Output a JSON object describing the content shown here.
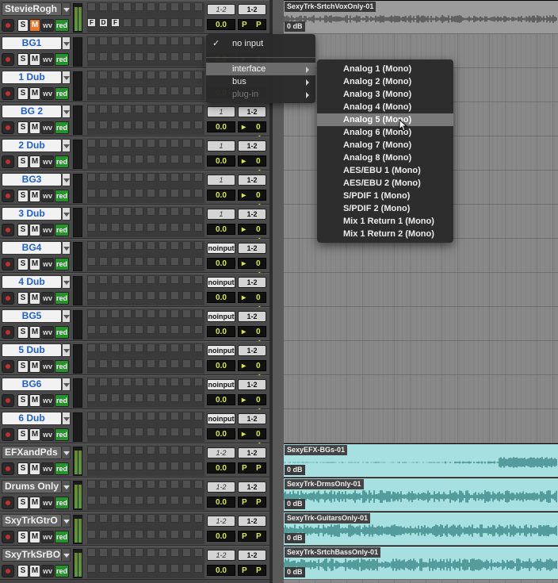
{
  "tracks": [
    {
      "name": "StevieRogh",
      "style": "gray",
      "m_on": true,
      "io1": "1-2",
      "io1_style": "italic",
      "io2": "1-2",
      "vol": "0.0",
      "pan_a": "P",
      "pan_b": "P",
      "extra_ins": [
        "F",
        "D",
        "F"
      ]
    },
    {
      "name": "BG1",
      "style": "blue",
      "m_on": false,
      "io1": "",
      "io2": "",
      "vol": "0.0",
      "pan_a": "▸",
      "pan_b": "0 ◂"
    },
    {
      "name": "1 Dub",
      "style": "blue",
      "m_on": false,
      "io1": "",
      "io2": "",
      "vol": "0.0",
      "pan_a": "▸",
      "pan_b": "0 ◂"
    },
    {
      "name": "BG 2",
      "style": "blue",
      "m_on": false,
      "io1": "1",
      "io1_style": "italic",
      "io2": "1-2",
      "vol": "0.0",
      "pan_a": "▸",
      "pan_b": "0 ◂"
    },
    {
      "name": "2 Dub",
      "style": "blue",
      "m_on": false,
      "io1": "1",
      "io1_style": "italic",
      "io2": "1-2",
      "vol": "0.0",
      "pan_a": "▸",
      "pan_b": "0 ◂"
    },
    {
      "name": "BG3",
      "style": "blue",
      "m_on": false,
      "io1": "1",
      "io1_style": "italic",
      "io2": "1-2",
      "vol": "0.0",
      "pan_a": "▸",
      "pan_b": "0 ◂"
    },
    {
      "name": "3 Dub",
      "style": "blue",
      "m_on": false,
      "io1": "1",
      "io1_style": "italic",
      "io2": "1-2",
      "vol": "0.0",
      "pan_a": "▸",
      "pan_b": "0 ◂"
    },
    {
      "name": "BG4",
      "style": "blue",
      "m_on": false,
      "io1": "noinput",
      "io1_style": "ni",
      "io2": "1-2",
      "vol": "0.0",
      "pan_a": "▸",
      "pan_b": "0 ◂"
    },
    {
      "name": "4 Dub",
      "style": "blue",
      "m_on": false,
      "io1": "noinput",
      "io1_style": "ni",
      "io2": "1-2",
      "vol": "0.0",
      "pan_a": "▸",
      "pan_b": "0 ◂"
    },
    {
      "name": "BG5",
      "style": "blue",
      "m_on": false,
      "io1": "noinput",
      "io1_style": "ni",
      "io2": "1-2",
      "vol": "0.0",
      "pan_a": "▸",
      "pan_b": "0 ◂"
    },
    {
      "name": "5 Dub",
      "style": "blue",
      "m_on": false,
      "io1": "noinput",
      "io1_style": "ni",
      "io2": "1-2",
      "vol": "0.0",
      "pan_a": "▸",
      "pan_b": "0 ◂"
    },
    {
      "name": "BG6",
      "style": "blue",
      "m_on": false,
      "io1": "noinput",
      "io1_style": "ni",
      "io2": "1-2",
      "vol": "0.0",
      "pan_a": "▸",
      "pan_b": "0 ◂"
    },
    {
      "name": "6 Dub",
      "style": "blue",
      "m_on": false,
      "io1": "noinput",
      "io1_style": "ni",
      "io2": "1-2",
      "vol": "0.0",
      "pan_a": "▸",
      "pan_b": "0 ◂"
    },
    {
      "name": "EFXandPds",
      "style": "gray",
      "m_on": false,
      "io1": "1-2",
      "io1_style": "italic",
      "io2": "1-2",
      "vol": "0.0",
      "pan_a": "P",
      "pan_b": "P"
    },
    {
      "name": "Drums Only",
      "style": "gray",
      "m_on": false,
      "io1": "1-2",
      "io1_style": "italic",
      "io2": "1-2",
      "vol": "0.0",
      "pan_a": "P",
      "pan_b": "P"
    },
    {
      "name": "SxyTrkGtrO",
      "style": "gray",
      "m_on": false,
      "io1": "1-2",
      "io1_style": "italic",
      "io2": "1-2",
      "vol": "0.0",
      "pan_a": "P",
      "pan_b": "P"
    },
    {
      "name": "SxyTrkSrBO",
      "style": "gray",
      "m_on": false,
      "io1": "1-2",
      "io1_style": "italic",
      "io2": "1-2",
      "vol": "0.0",
      "pan_a": "P",
      "pan_b": "P"
    }
  ],
  "buttons": {
    "s": "S",
    "m": "M",
    "wv": "wv",
    "red": "red"
  },
  "clips": [
    {
      "track_index": 0,
      "name": "SexyTrk-SrtchVoxOnly-01",
      "gain": "0 dB",
      "color": "gray"
    },
    {
      "track_index": 13,
      "name": "SexyEFX-BGs-01",
      "gain": "0 dB",
      "color": "teal"
    },
    {
      "track_index": 14,
      "name": "SexyTrk-DrmsOnly-01",
      "gain": "0 dB",
      "color": "teal"
    },
    {
      "track_index": 15,
      "name": "SexyTrk-GuitarsOnly-01",
      "gain": "0 dB",
      "color": "teal"
    },
    {
      "track_index": 16,
      "name": "SexyTrk-SrtchBassOnly-01",
      "gain": "0 dB",
      "color": "teal"
    }
  ],
  "input_menu": {
    "checked_item": "no input",
    "check_mark": "✓",
    "items": [
      {
        "label": "interface",
        "submenu": true,
        "highlighted": true
      },
      {
        "label": "bus",
        "submenu": true
      },
      {
        "label": "plug-in",
        "submenu": true,
        "disabled": true
      }
    ]
  },
  "interface_submenu": {
    "highlighted": "Analog 5 (Mono)",
    "items": [
      "Analog 1 (Mono)",
      "Analog 2 (Mono)",
      "Analog 3 (Mono)",
      "Analog 4 (Mono)",
      "Analog 5 (Mono)",
      "Analog 6 (Mono)",
      "Analog 7 (Mono)",
      "Analog 8 (Mono)",
      "AES/EBU 1 (Mono)",
      "AES/EBU 2 (Mono)",
      "S/PDIF 1 (Mono)",
      "S/PDIF 2 (Mono)",
      "Mix 1 Return 1 (Mono)",
      "Mix 1 Return 2 (Mono)"
    ]
  }
}
